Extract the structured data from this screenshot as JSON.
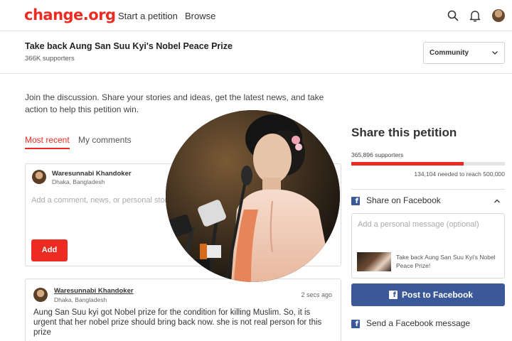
{
  "header": {
    "logo": "change.org",
    "nav": [
      "Start a petition",
      "Browse"
    ]
  },
  "petition": {
    "title": "Take back Aung San Suu Kyi's Nobel Peace Prize",
    "supporters": "366K supporters",
    "filter_label": "Community"
  },
  "intro": "Join the discussion. Share your stories and ideas, get the latest news, and take action to help this petition win.",
  "tabs": [
    "Most recent",
    "My comments"
  ],
  "composer": {
    "user_name": "Waresunnabi Khandoker",
    "location": "Dhaka, Bangladesh",
    "placeholder": "Add a comment, news, or personal story",
    "add_label": "Add"
  },
  "comment": {
    "user_name": "Waresunnabi Khandoker",
    "location": "Dhaka, Bangladesh",
    "time": "2 secs ago",
    "text": "Aung San Suu kyi got Nobel prize for the condition for killing Muslim. So, it is urgent that her nobel prize should bring back now. she is not real person for this prize"
  },
  "share": {
    "title": "Share this petition",
    "supporters": "365,896 supporters",
    "progress_fraction": 0.73,
    "needed": "134,104 needed to reach 500,000",
    "fb_share_label": "Share on Facebook",
    "message_placeholder": "Add a personal message (optional)",
    "preview_caption": "Take back Aung San Suu Kyi's Nobel Peace Prize!",
    "post_button": "Post to Facebook",
    "fb_message_label": "Send a Facebook message"
  },
  "colors": {
    "brand_red": "#ec2c22",
    "facebook_blue": "#3b5998"
  },
  "icons": [
    "search-icon",
    "bell-icon",
    "chevron-down-icon",
    "facebook-icon",
    "chevron-up-icon"
  ]
}
